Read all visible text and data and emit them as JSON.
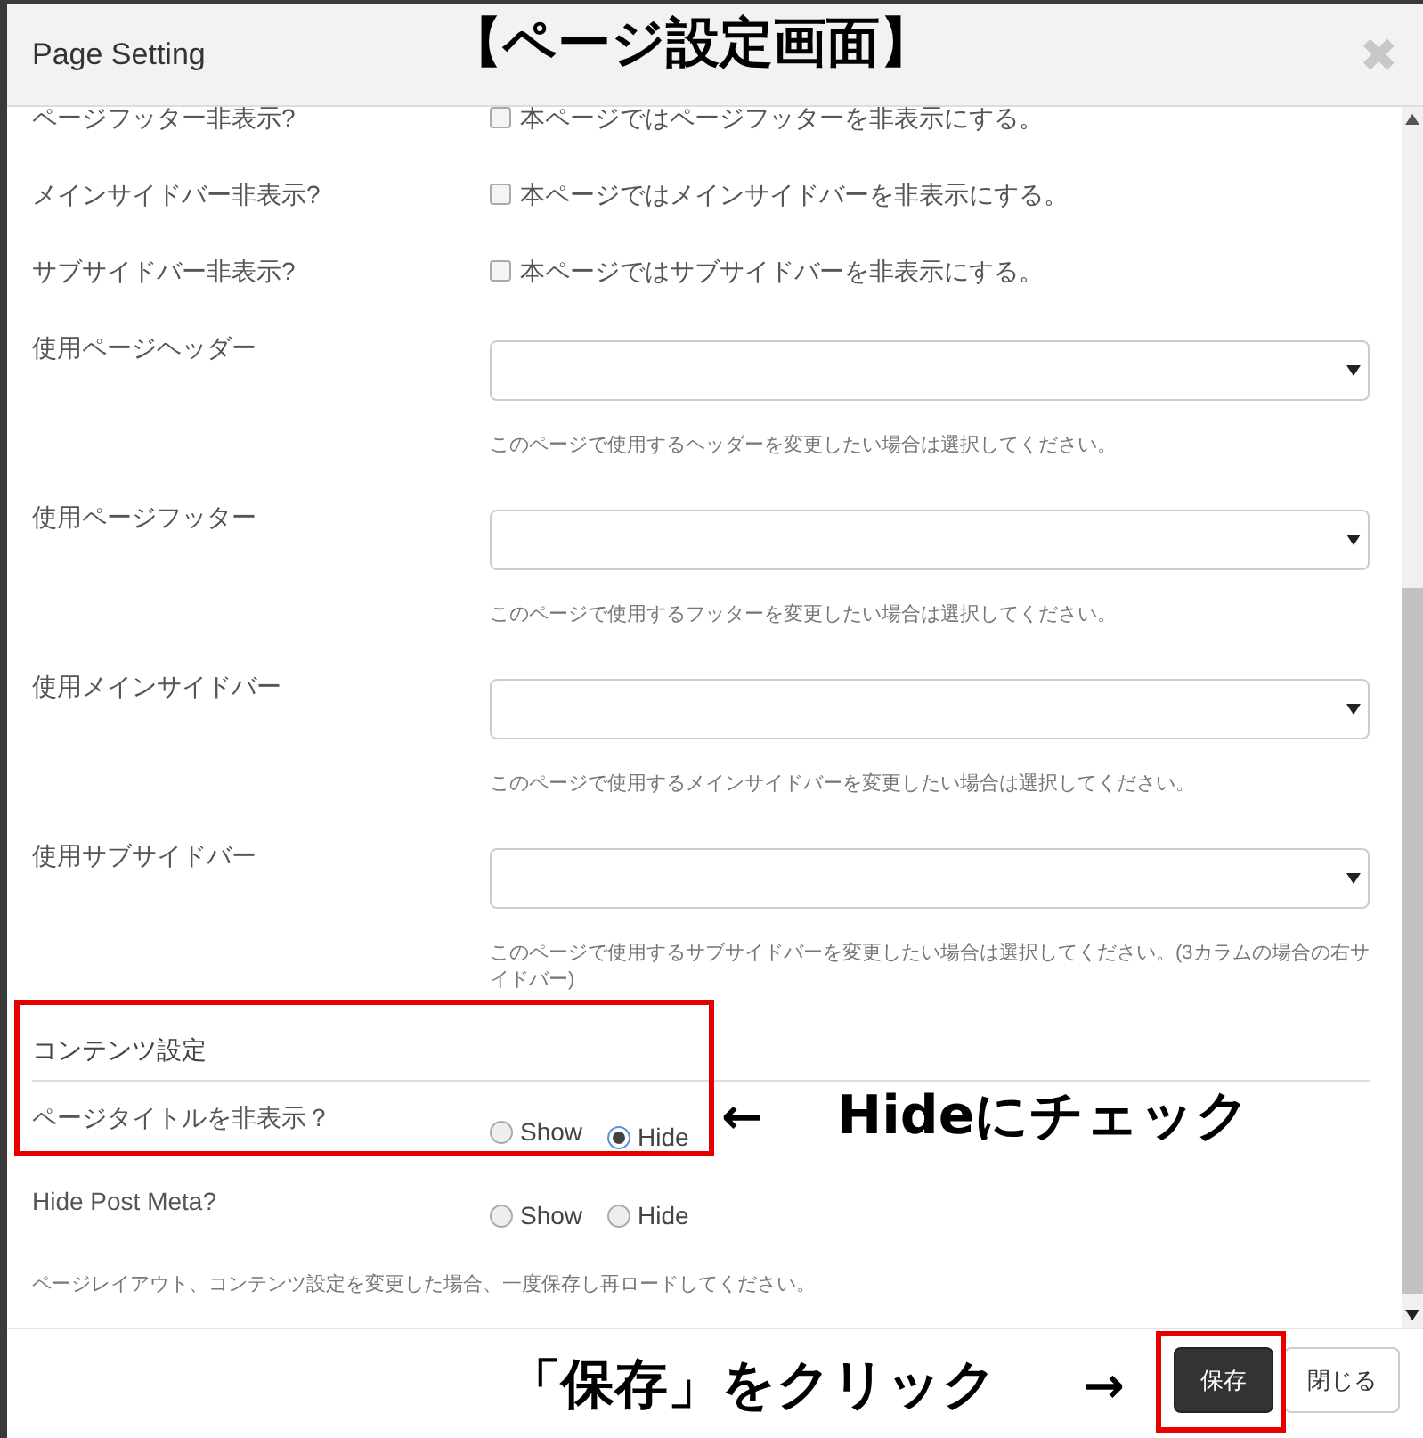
{
  "window": {
    "title": "Page Setting",
    "close": "✖"
  },
  "checkbox_rows": [
    {
      "label": "ページフッター非表示?",
      "option": "本ページではページフッターを非表示にする。",
      "checked": false
    },
    {
      "label": "メインサイドバー非表示?",
      "option": "本ページではメインサイドバーを非表示にする。",
      "checked": false
    },
    {
      "label": "サブサイドバー非表示?",
      "option": "本ページではサブサイドバーを非表示にする。",
      "checked": false
    }
  ],
  "select_rows": [
    {
      "label": "使用ページヘッダー",
      "help": "このページで使用するヘッダーを変更したい場合は選択してください。"
    },
    {
      "label": "使用ページフッター",
      "help": "このページで使用するフッターを変更したい場合は選択してください。"
    },
    {
      "label": "使用メインサイドバー",
      "help": "このページで使用するメインサイドバーを変更したい場合は選択してください。"
    },
    {
      "label": "使用サブサイドバー",
      "help": "このページで使用するサブサイドバーを変更したい場合は選択してください。(3カラムの場合の右サイドバー)"
    }
  ],
  "section": {
    "title": "コンテンツ設定"
  },
  "radio_rows": [
    {
      "label": "ページタイトルを非表示？",
      "options": [
        {
          "label": "Show",
          "selected": false
        },
        {
          "label": "Hide",
          "selected": true
        }
      ]
    },
    {
      "label": "Hide Post Meta?",
      "options": [
        {
          "label": "Show",
          "selected": false
        },
        {
          "label": "Hide",
          "selected": false
        }
      ]
    }
  ],
  "note": "ページレイアウト、コンテンツ設定を変更した場合、一度保存し再ロードしてください。",
  "buttons": [
    {
      "label": "保存",
      "kind": "primary"
    },
    {
      "label": "閉じる",
      "kind": "default"
    }
  ],
  "annotations": [
    {
      "kind": "heading",
      "text": "【ページ設定画面】"
    },
    {
      "kind": "arrow",
      "text": "←"
    },
    {
      "kind": "callout",
      "text": "Hideにチェック"
    },
    {
      "kind": "callout",
      "text": "「保存」をクリック"
    },
    {
      "kind": "arrow",
      "text": "→"
    }
  ]
}
